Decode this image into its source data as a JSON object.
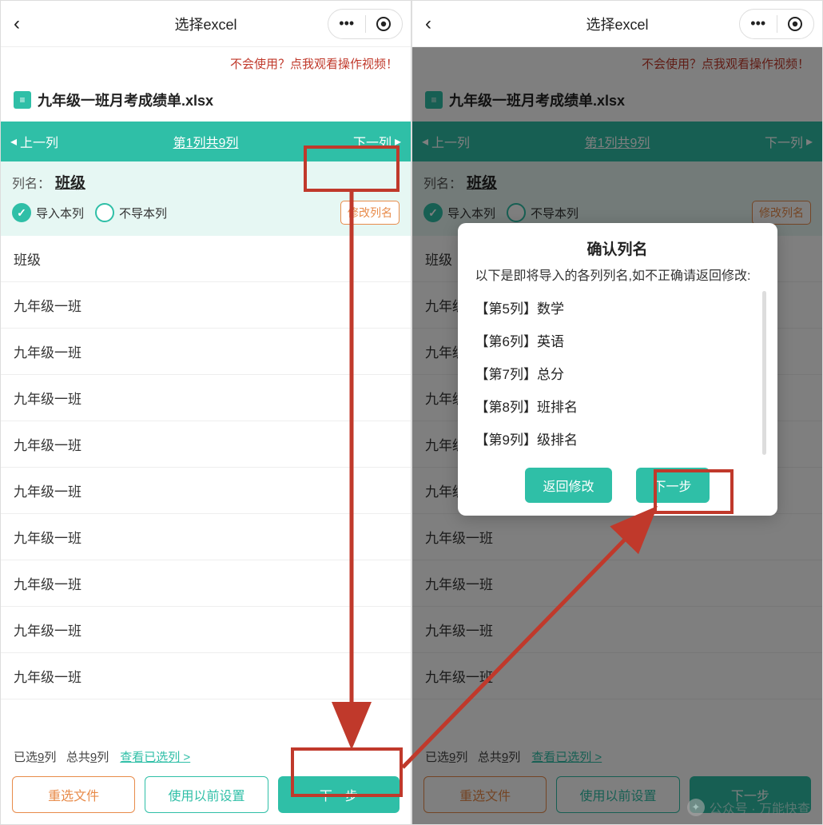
{
  "header": {
    "title": "选择excel",
    "back_glyph": "‹"
  },
  "help_banner": "不会使用？点我观看操作视频！",
  "file": {
    "name": "九年级一班月考成绩单.xlsx",
    "icon_glyph": "≡"
  },
  "colnav": {
    "prev": "上一列",
    "mid": "第1列共9列",
    "next": "下一列",
    "tri_left": "◂",
    "tri_right": "▸"
  },
  "colinfo": {
    "label": "列名：",
    "name": "班级",
    "opt_import": "导入本列",
    "opt_skip": "不导本列",
    "edit": "修改列名"
  },
  "rows": [
    "班级",
    "九年级一班",
    "九年级一班",
    "九年级一班",
    "九年级一班",
    "九年级一班",
    "九年级一班",
    "九年级一班",
    "九年级一班",
    "九年级一班"
  ],
  "footer": {
    "selected_prefix": "已选",
    "selected_count": "9",
    "selected_suffix": "列",
    "total_prefix": "总共",
    "total_count": "9",
    "total_suffix": "列",
    "view_link": "查看已选列 >",
    "btn_reselect": "重选文件",
    "btn_prev_settings": "使用以前设置",
    "btn_next": "下一步"
  },
  "dialog": {
    "title": "确认列名",
    "sub": "以下是即将导入的各列列名,如不正确请返回修改:",
    "items": [
      "【第5列】数学",
      "【第6列】英语",
      "【第7列】总分",
      "【第8列】班排名",
      "【第9列】级排名"
    ],
    "btn_back": "返回修改",
    "btn_next": "下一步"
  },
  "watermark": "公众号 · 万能快查"
}
